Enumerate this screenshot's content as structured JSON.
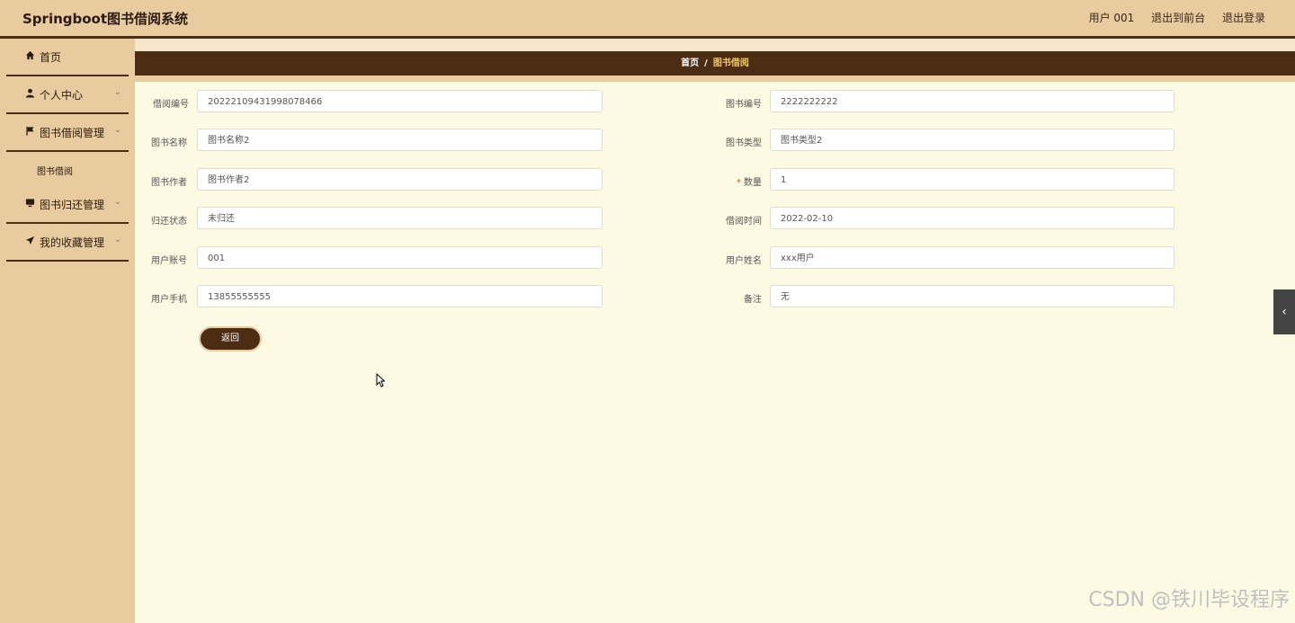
{
  "header": {
    "app_title": "Springboot图书借阅系统",
    "user_label": "用户 001",
    "exit_front": "退出到前台",
    "logout": "退出登录"
  },
  "sidebar": {
    "items": [
      {
        "label": "首页",
        "icon": "home-icon"
      },
      {
        "label": "个人中心",
        "icon": "user-icon"
      },
      {
        "label": "图书借阅管理",
        "icon": "flag-icon"
      },
      {
        "label": "图书归还管理",
        "icon": "monitor-icon"
      },
      {
        "label": "我的收藏管理",
        "icon": "send-icon"
      }
    ],
    "sub_item": "图书借阅"
  },
  "breadcrumb": {
    "home": "首页",
    "separator": "/",
    "current": "图书借阅"
  },
  "form": {
    "fields": [
      {
        "label": "借阅编号",
        "value": "20222109431998078466"
      },
      {
        "label": "图书编号",
        "value": "2222222222"
      },
      {
        "label": "图书名称",
        "value": "图书名称2"
      },
      {
        "label": "图书类型",
        "value": "图书类型2"
      },
      {
        "label": "图书作者",
        "value": "图书作者2"
      },
      {
        "label": "数量",
        "value": "1",
        "required_mark": "*"
      },
      {
        "label": "归还状态",
        "value": "未归还"
      },
      {
        "label": "借阅时间",
        "value": "2022-02-10"
      },
      {
        "label": "用户账号",
        "value": "001"
      },
      {
        "label": "用户姓名",
        "value": "xxx用户"
      },
      {
        "label": "用户手机",
        "value": "13855555555"
      },
      {
        "label": "备注",
        "value": "无"
      }
    ],
    "back_button": "返回"
  },
  "watermark": "CSDN @铁川毕设程序",
  "colors": {
    "header_bg": "#e9cba0",
    "accent_dark": "#4d2c14",
    "content_bg": "#fdfae3",
    "breadcrumb_current": "#f0c96a"
  }
}
